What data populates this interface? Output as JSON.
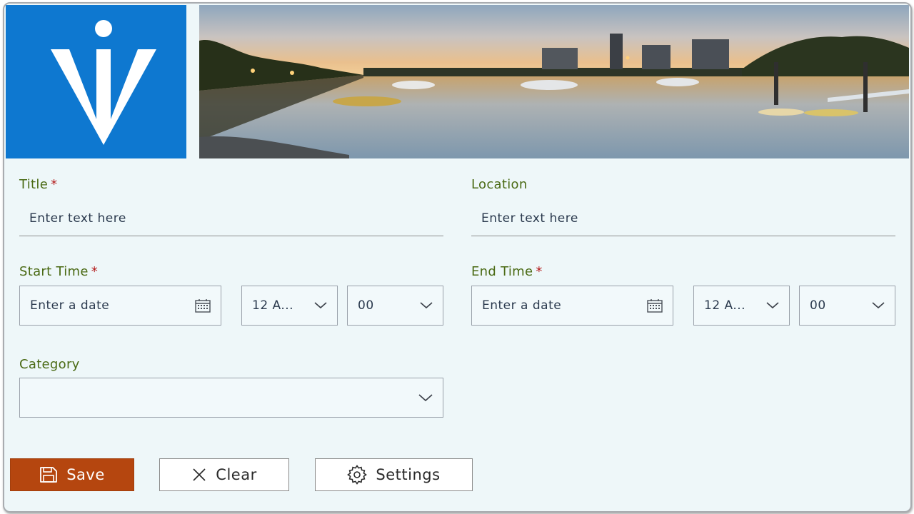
{
  "header": {
    "logo_icon": "info-person-logo",
    "banner_image": "harbour-sunset-photo"
  },
  "form": {
    "title": {
      "label": "Title",
      "required_mark": "*",
      "placeholder": "Enter text here"
    },
    "location": {
      "label": "Location",
      "placeholder": "Enter text here"
    },
    "start_time": {
      "label": "Start Time",
      "required_mark": "*",
      "date_placeholder": "Enter a date",
      "hour": "12 A...",
      "minute": "00"
    },
    "end_time": {
      "label": "End Time",
      "required_mark": "*",
      "date_placeholder": "Enter a date",
      "hour": "12 A...",
      "minute": "00"
    },
    "category": {
      "label": "Category",
      "value": ""
    }
  },
  "actions": {
    "save": {
      "label": "Save",
      "icon": "save-icon"
    },
    "clear": {
      "label": "Clear",
      "icon": "close-icon"
    },
    "settings": {
      "label": "Settings",
      "icon": "gear-icon"
    }
  },
  "colors": {
    "logo_bg": "#0e78d0",
    "form_bg": "#eef7f9",
    "label": "#4a6a14",
    "required": "#b31b1b",
    "save_bg": "#b5460f"
  }
}
